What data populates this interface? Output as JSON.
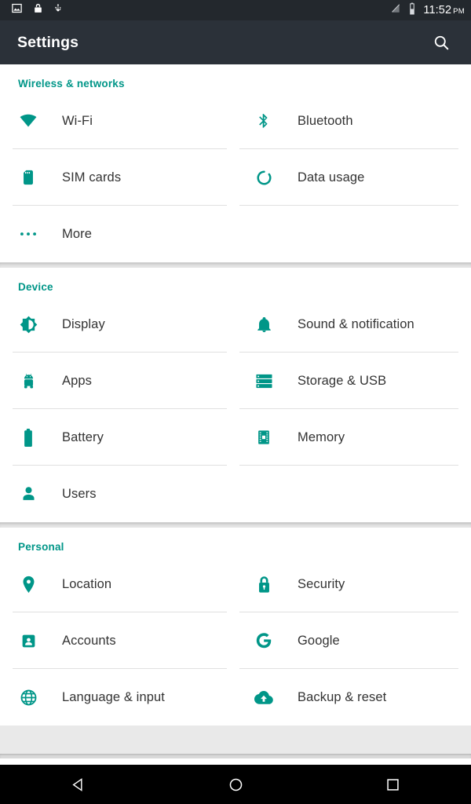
{
  "status_bar": {
    "left_icons": [
      "image-icon",
      "lock-icon",
      "usb-icon"
    ],
    "right_icons": [
      "no-signal-icon",
      "battery-half-icon"
    ],
    "time": "11:52",
    "ampm": "PM",
    "background": "#23282d"
  },
  "action_bar": {
    "title": "Settings",
    "search_icon": "search-icon",
    "background": "#2b3139"
  },
  "theme": {
    "accent": "#009688",
    "label_text": "#333333",
    "divider": "#e0e0e0",
    "section_gap": "#e4e4e4"
  },
  "sections": [
    {
      "header": "Wireless & networks",
      "items": [
        {
          "label": "Wi-Fi",
          "icon": "wifi-icon"
        },
        {
          "label": "Bluetooth",
          "icon": "bluetooth-icon"
        },
        {
          "label": "SIM cards",
          "icon": "sim-card-icon"
        },
        {
          "label": "Data usage",
          "icon": "data-usage-icon"
        },
        {
          "label": "More",
          "icon": "more-horizontal-icon"
        }
      ]
    },
    {
      "header": "Device",
      "items": [
        {
          "label": "Sound & notification",
          "icon": "bell-icon"
        },
        {
          "label": "Display",
          "icon": "brightness-icon"
        },
        {
          "label": "Apps",
          "icon": "android-icon"
        },
        {
          "label": "Storage & USB",
          "icon": "storage-icon"
        },
        {
          "label": "Battery",
          "icon": "battery-icon"
        },
        {
          "label": "Memory",
          "icon": "memory-chip-icon"
        },
        {
          "label": "Users",
          "icon": "person-icon"
        }
      ]
    },
    {
      "header": "Personal",
      "items": [
        {
          "label": "Location",
          "icon": "location-pin-icon"
        },
        {
          "label": "Security",
          "icon": "lock-icon"
        },
        {
          "label": "Accounts",
          "icon": "account-badge-icon"
        },
        {
          "label": "Google",
          "icon": "google-g-icon"
        },
        {
          "label": "Language & input",
          "icon": "globe-icon"
        },
        {
          "label": "Backup & reset",
          "icon": "cloud-upload-icon"
        }
      ]
    }
  ],
  "nav_bar": {
    "buttons": [
      {
        "name": "back-button",
        "icon": "triangle-left-icon"
      },
      {
        "name": "home-button",
        "icon": "circle-icon"
      },
      {
        "name": "recents-button",
        "icon": "square-icon"
      }
    ],
    "background": "#000000"
  }
}
